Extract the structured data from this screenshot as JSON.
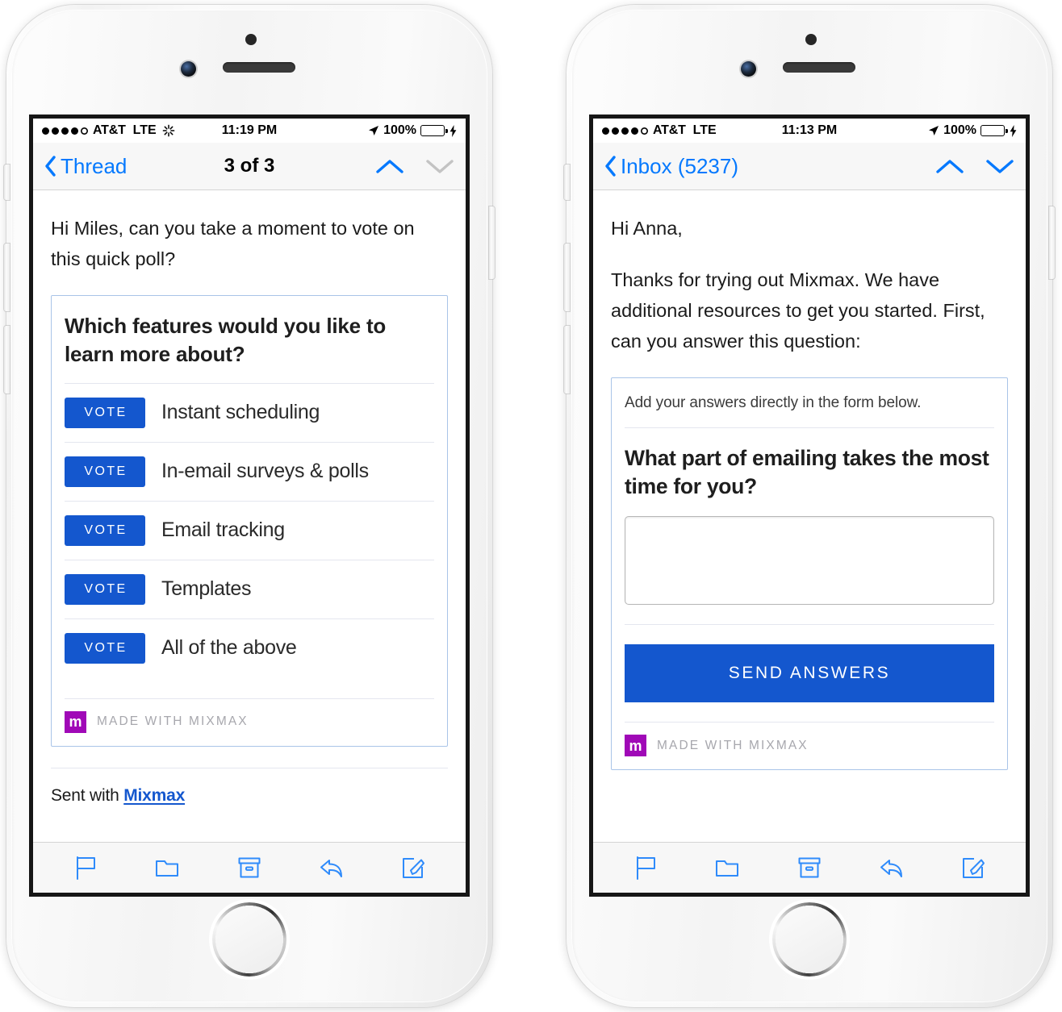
{
  "phones": [
    {
      "id": "left",
      "status_bar": {
        "signal_dots_filled": 4,
        "signal_dots_total": 5,
        "carrier": "AT&T",
        "network": "LTE",
        "activity_icon": "spinner-icon",
        "time": "11:19 PM",
        "location_icon": "location-arrow-icon",
        "battery_percent": "100%",
        "battery_level": 100,
        "battery_color": "#4cd964",
        "charging_icon": "lightning-bolt-icon"
      },
      "nav": {
        "back_label": "Thread",
        "title": "3 of 3",
        "up_icon": "chevron-up-icon",
        "down_icon": "chevron-down-icon",
        "up_enabled": true,
        "down_enabled": false
      },
      "body": {
        "greeting_lines": "Hi Miles, can you take a moment to vote on this quick poll?",
        "card": {
          "type": "poll",
          "question": "Which features would you like to learn more about?",
          "vote_label": "VOTE",
          "options": [
            "Instant scheduling",
            "In-email surveys & polls",
            "Email tracking",
            "Templates",
            "All of the above"
          ],
          "footer": {
            "logo_letter": "m",
            "logo_color": "#a009b7",
            "label": "MADE WITH MIXMAX"
          }
        },
        "sent_with_prefix": "Sent with ",
        "sent_with_link": "Mixmax"
      },
      "toolbar": [
        {
          "name": "flag-icon",
          "label": "Flag"
        },
        {
          "name": "folder-icon",
          "label": "Move to folder"
        },
        {
          "name": "archive-icon",
          "label": "Archive"
        },
        {
          "name": "reply-icon",
          "label": "Reply"
        },
        {
          "name": "compose-icon",
          "label": "Compose"
        }
      ]
    },
    {
      "id": "right",
      "status_bar": {
        "signal_dots_filled": 4,
        "signal_dots_total": 5,
        "carrier": "AT&T",
        "network": "LTE",
        "activity_icon": "",
        "time": "11:13 PM",
        "location_icon": "location-arrow-icon",
        "battery_percent": "100%",
        "battery_level": 100,
        "battery_color": "#4cd964",
        "charging_icon": "lightning-bolt-icon"
      },
      "nav": {
        "back_label": "Inbox (5237)",
        "title": "",
        "up_icon": "chevron-up-icon",
        "down_icon": "chevron-down-icon",
        "up_enabled": true,
        "down_enabled": true
      },
      "body": {
        "greeting": "Hi Anna,",
        "paragraph": "Thanks for trying out Mixmax. We have additional resources to get you started. First, can you answer this question:",
        "card": {
          "type": "survey",
          "note": "Add your answers directly in the form below.",
          "question": "What part of emailing takes the most time for you?",
          "answer_value": "",
          "answer_placeholder": "",
          "submit_label": "SEND ANSWERS",
          "footer": {
            "logo_letter": "m",
            "logo_color": "#a009b7",
            "label": "MADE WITH MIXMAX"
          }
        }
      },
      "toolbar": [
        {
          "name": "flag-icon",
          "label": "Flag"
        },
        {
          "name": "folder-icon",
          "label": "Move to folder"
        },
        {
          "name": "archive-icon",
          "label": "Archive"
        },
        {
          "name": "reply-icon",
          "label": "Reply"
        },
        {
          "name": "compose-icon",
          "label": "Compose"
        }
      ]
    }
  ],
  "theme": {
    "ios_blue": "#0579fe",
    "mixmax_blue": "#1457ce",
    "mixmax_purple": "#a009b7",
    "card_border": "#a9c4e8",
    "separator": "#e4e6ef"
  }
}
